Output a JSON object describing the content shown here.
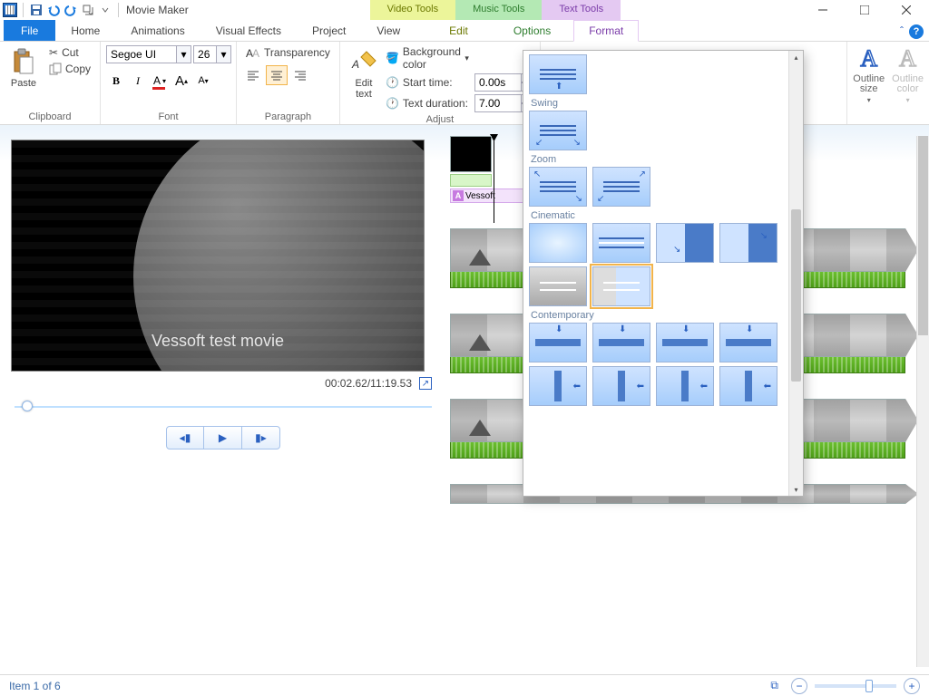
{
  "titlebar": {
    "title": "Movie Maker"
  },
  "tooltabs": {
    "video": "Video Tools",
    "music": "Music Tools",
    "text": "Text Tools"
  },
  "tabs": {
    "file": "File",
    "home": "Home",
    "animations": "Animations",
    "visual_effects": "Visual Effects",
    "project": "Project",
    "view": "View",
    "video_edit": "Edit",
    "music_options": "Options",
    "text_format": "Format"
  },
  "ribbon": {
    "clipboard": {
      "label": "Clipboard",
      "paste": "Paste",
      "cut": "Cut",
      "copy": "Copy"
    },
    "font": {
      "label": "Font",
      "family": "Segoe UI",
      "size": "26",
      "bold": "B",
      "italic": "I",
      "color": "A",
      "grow": "A",
      "shrink": "A",
      "transparency": "Transparency"
    },
    "paragraph": {
      "label": "Paragraph"
    },
    "adjust": {
      "label": "Adjust",
      "edit_text": "Edit\ntext",
      "bgcolor": "Background color",
      "start_time": "Start time:",
      "text_duration": "Text duration:",
      "start_val": "0.00s",
      "dur_val": "7.00"
    },
    "effects": {
      "swing": "Swing",
      "zoom": "Zoom",
      "cinematic": "Cinematic",
      "contemporary": "Contemporary"
    },
    "outline": {
      "size": "Outline\nsize",
      "color": "Outline\ncolor"
    }
  },
  "preview": {
    "caption": "Vessoft test movie",
    "time": "00:02.62/11:19.53"
  },
  "timeline": {
    "text_clip_label": "Vessoft",
    "text_clip_icon": "A"
  },
  "statusbar": {
    "item": "Item 1 of 6"
  }
}
